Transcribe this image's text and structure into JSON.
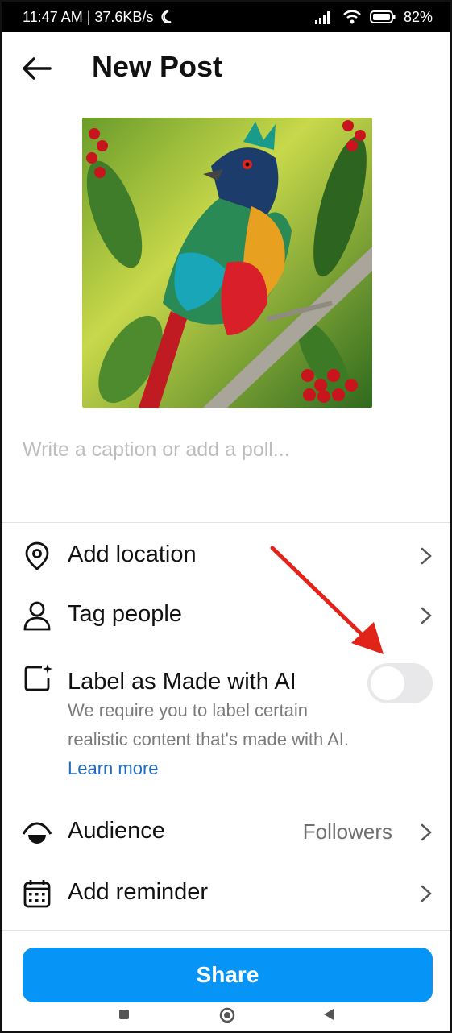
{
  "status": {
    "time_speed": "11:47 AM | 37.6KB/s",
    "battery": "82%"
  },
  "header": {
    "title": "New Post"
  },
  "caption": {
    "placeholder": "Write a caption or add a poll..."
  },
  "options": [
    {
      "label": "Add location",
      "icon": "location-pin-icon"
    },
    {
      "label": "Tag people",
      "icon": "person-icon"
    }
  ],
  "ai_label": {
    "title": "Label as Made with AI",
    "description": "We require you to label certain realistic content that's made with AI.",
    "learn_more": "Learn more",
    "enabled": false
  },
  "audience": {
    "label": "Audience",
    "value": "Followers"
  },
  "reminder": {
    "label": "Add reminder"
  },
  "share_button": {
    "label": "Share"
  },
  "colors": {
    "accent": "#0695f6",
    "link": "#1f6cc6",
    "arrow": "#e2231a"
  }
}
